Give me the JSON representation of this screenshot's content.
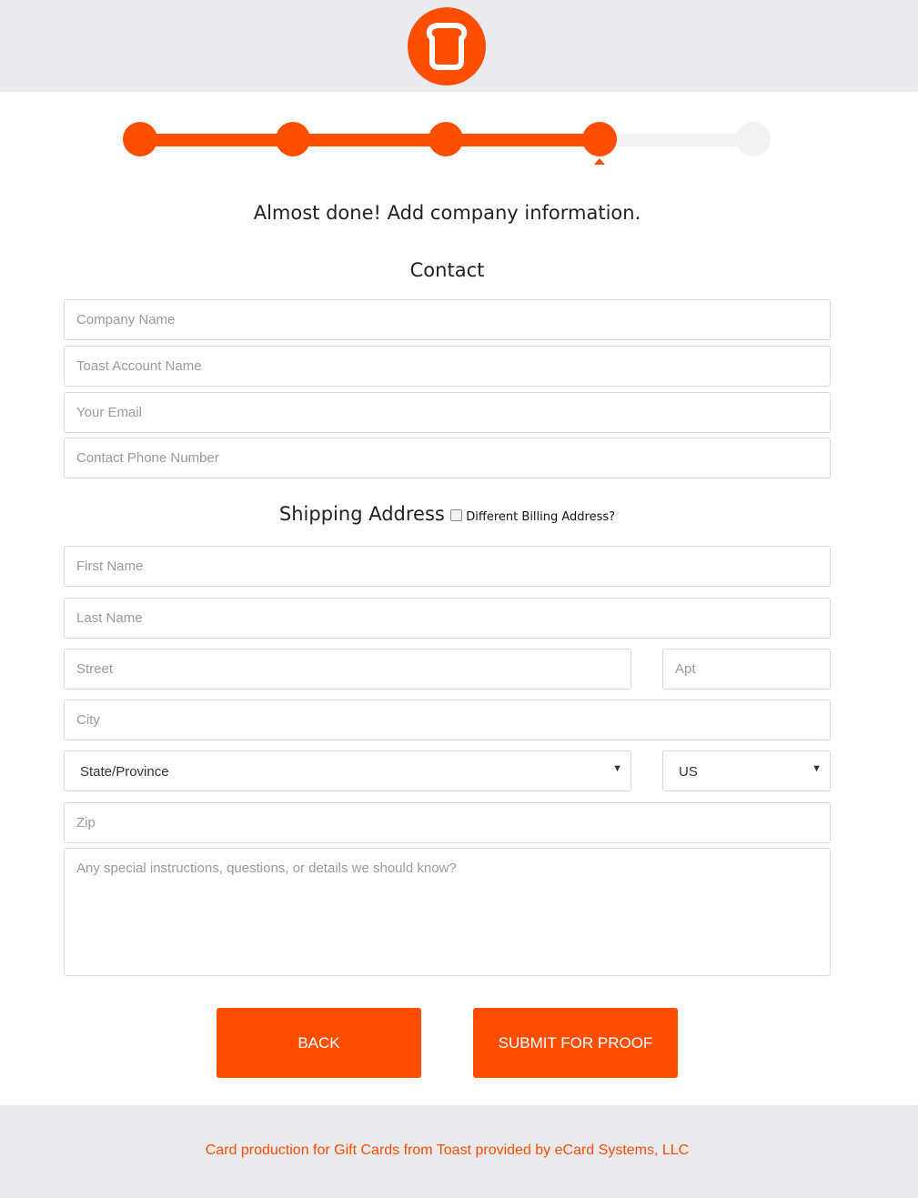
{
  "colors": {
    "accent": "#ff4e00",
    "header_bg": "#ebebef",
    "track_inactive": "#f2f2f2"
  },
  "logo": {
    "icon": "toast-logo-icon"
  },
  "progress": {
    "total_steps": 5,
    "completed_steps": 4,
    "current_step": 4
  },
  "page": {
    "heading": "Almost done! Add company information."
  },
  "contact": {
    "title": "Contact",
    "company_name_placeholder": "Company Name",
    "toast_account_placeholder": "Toast Account Name",
    "email_placeholder": "Your Email",
    "phone_placeholder": "Contact Phone Number"
  },
  "shipping": {
    "title": "Shipping Address",
    "different_billing_label": "Different Billing Address?",
    "different_billing_checked": false,
    "first_name_placeholder": "First Name",
    "last_name_placeholder": "Last Name",
    "street_placeholder": "Street",
    "apt_placeholder": "Apt",
    "city_placeholder": "City",
    "state_selected": "State/Province",
    "country_selected": "US",
    "zip_placeholder": "Zip",
    "instructions_placeholder": "Any special instructions, questions, or details we should know?"
  },
  "actions": {
    "back_label": "BACK",
    "submit_label": "SUBMIT FOR PROOF"
  },
  "footer": {
    "text": "Card production for Gift Cards from Toast provided by eCard Systems, LLC"
  }
}
